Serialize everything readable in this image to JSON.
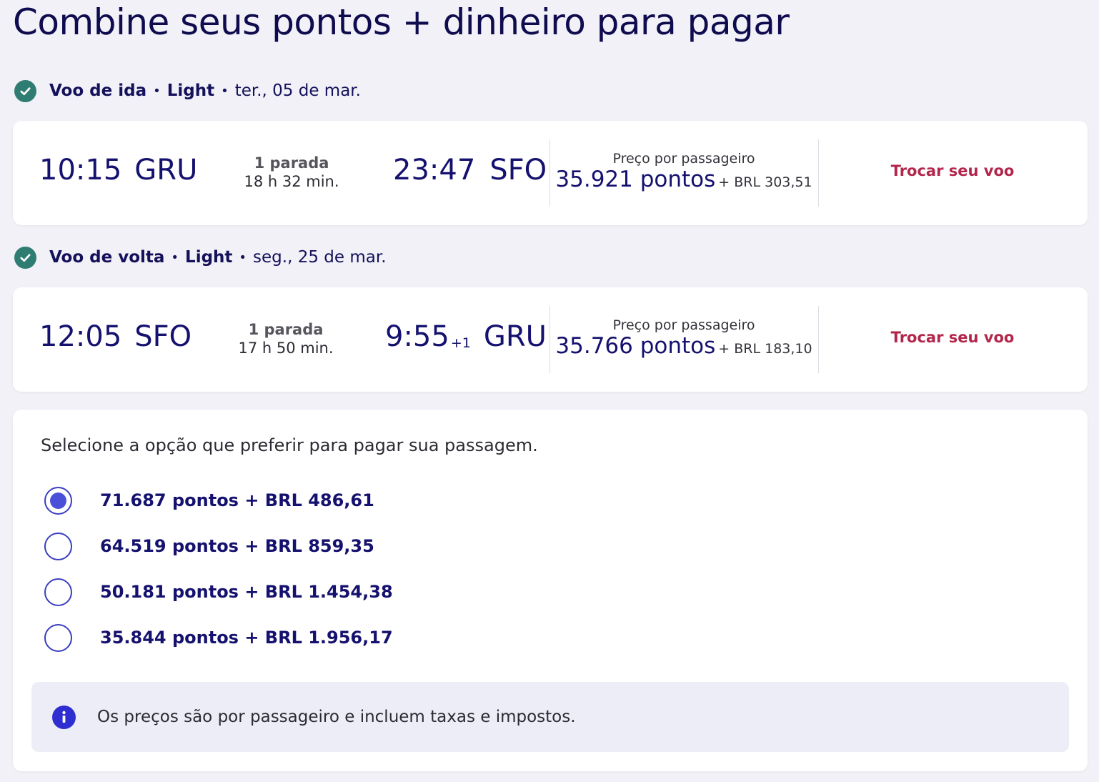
{
  "page": {
    "title": "Combine seus pontos + dinheiro para pagar"
  },
  "outbound": {
    "header": {
      "label": "Voo de ida",
      "fare": "Light",
      "date": "ter., 05 de mar."
    },
    "departure": {
      "time": "10:15",
      "airport": "GRU"
    },
    "stops": {
      "count_label": "1 parada",
      "duration": "18 h 32 min."
    },
    "arrival": {
      "time": "23:47",
      "day_offset": "",
      "airport": "SFO"
    },
    "price": {
      "label": "Preço por passageiro",
      "points": "35.921 pontos",
      "cash": "+ BRL 303,51"
    },
    "change_label": "Trocar seu voo"
  },
  "inbound": {
    "header": {
      "label": "Voo de volta",
      "fare": "Light",
      "date": "seg., 25 de mar."
    },
    "departure": {
      "time": "12:05",
      "airport": "SFO"
    },
    "stops": {
      "count_label": "1 parada",
      "duration": "17 h 50 min."
    },
    "arrival": {
      "time": "9:55",
      "day_offset": "+1",
      "airport": "GRU"
    },
    "price": {
      "label": "Preço por passageiro",
      "points": "35.766 pontos",
      "cash": "+ BRL 183,10"
    },
    "change_label": "Trocar seu voo"
  },
  "payment": {
    "intro": "Selecione a opção que preferir para pagar sua passagem.",
    "selected_index": 0,
    "options": [
      {
        "label": "71.687 pontos + BRL 486,61"
      },
      {
        "label": "64.519 pontos + BRL 859,35"
      },
      {
        "label": "50.181 pontos + BRL 1.454,38"
      },
      {
        "label": "35.844 pontos + BRL 1.956,17"
      }
    ],
    "info": "Os preços são por passageiro e incluem taxas e impostos."
  },
  "colors": {
    "background": "#f1f1f7",
    "heading_navy": "#0f0b4f",
    "check_green": "#2f7d72",
    "link_red": "#b3264b",
    "radio_blue": "#4b50d8",
    "info_blue": "#2f2fd1"
  },
  "icons": {
    "leg_confirmed": "check-circle-icon",
    "info": "info-icon"
  }
}
